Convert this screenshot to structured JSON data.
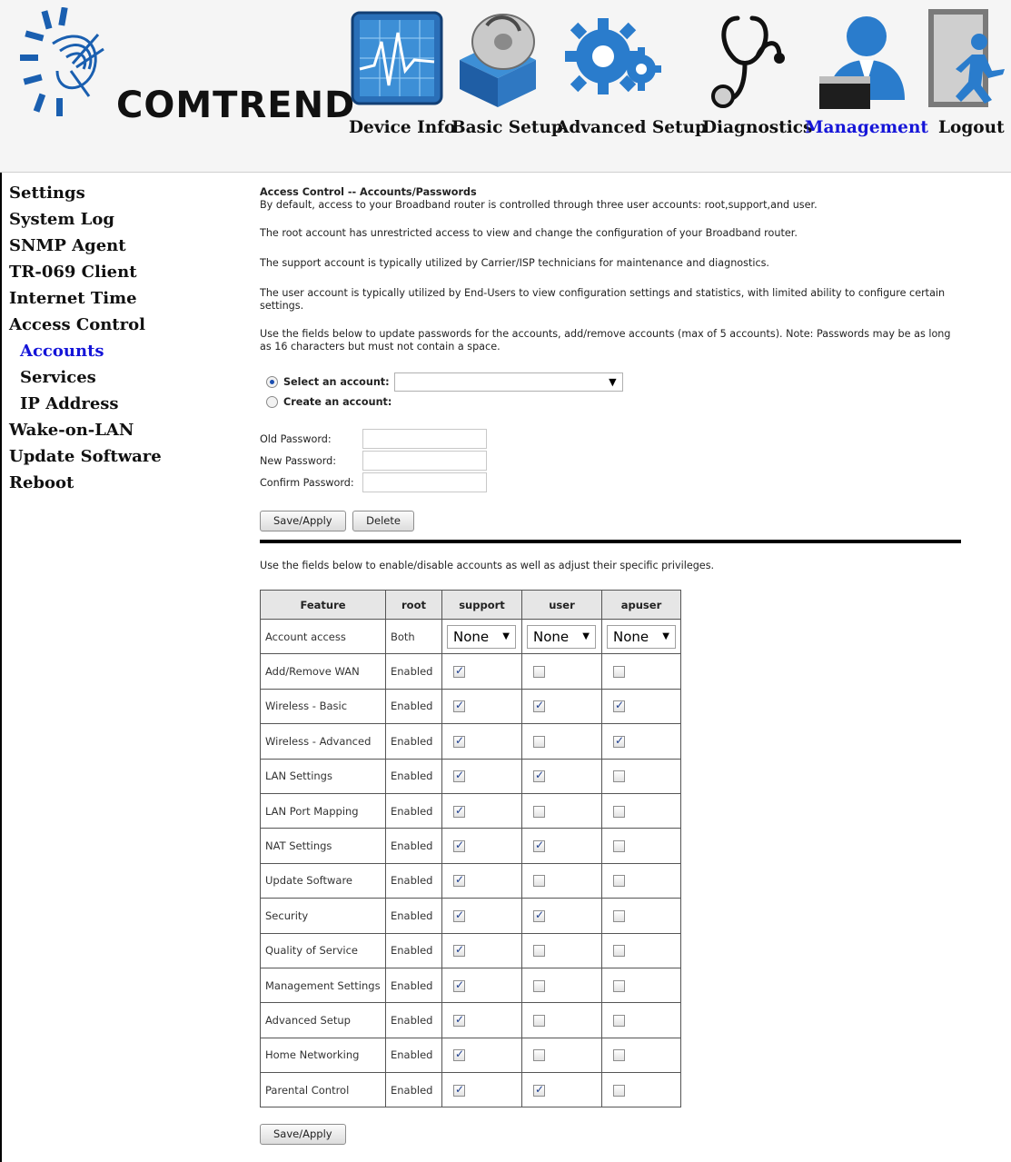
{
  "brand": {
    "name": "COMTREND"
  },
  "nav": [
    {
      "label": "Device Info",
      "icon": "device-info-icon"
    },
    {
      "label": "Basic Setup",
      "icon": "basic-setup-icon"
    },
    {
      "label": "Advanced Setup",
      "icon": "advanced-setup-icon"
    },
    {
      "label": "Diagnostics",
      "icon": "diagnostics-icon"
    },
    {
      "label": "Management",
      "icon": "management-icon",
      "active": true
    },
    {
      "label": "Logout",
      "icon": "logout-icon"
    }
  ],
  "sidebar": {
    "items": [
      {
        "label": "Settings"
      },
      {
        "label": "System Log"
      },
      {
        "label": "SNMP Agent"
      },
      {
        "label": "TR-069 Client"
      },
      {
        "label": "Internet Time"
      },
      {
        "label": "Access Control"
      },
      {
        "label": "Accounts",
        "sub": true,
        "active": true
      },
      {
        "label": "Services",
        "sub": true
      },
      {
        "label": "IP Address",
        "sub": true
      },
      {
        "label": "Wake-on-LAN"
      },
      {
        "label": "Update Software"
      },
      {
        "label": "Reboot"
      }
    ]
  },
  "main": {
    "title": "Access Control -- Accounts/Passwords",
    "intro": "By default, access to your Broadband router is controlled through three user accounts: root,support,and user.",
    "p_root": "The root account has unrestricted access to view and change the configuration of your Broadband router.",
    "p_support": "The support account is typically utilized by Carrier/ISP technicians for maintenance and diagnostics.",
    "p_user": "The user account is typically utilized by End-Users to view configuration settings and statistics, with limited ability to configure certain settings.",
    "p_fields": "Use the fields below to update passwords for the accounts, add/remove accounts (max of 5 accounts). Note: Passwords may be as long as 16 characters but must not contain a space.",
    "select_account_label": "Select an account:",
    "select_account_value": "",
    "create_account_label": "Create an account:",
    "old_password_label": "Old Password:",
    "new_password_label": "New Password:",
    "confirm_password_label": "Confirm Password:",
    "save_apply_label": "Save/Apply",
    "delete_label": "Delete",
    "privileges_intro": "Use the fields below to enable/disable accounts as well as adjust their specific privileges.",
    "save_apply_bottom_label": "Save/Apply"
  },
  "table": {
    "headers": [
      "Feature",
      "root",
      "support",
      "user",
      "apuser"
    ],
    "account_access": {
      "feature": "Account access",
      "root": "Both",
      "support": "None",
      "user": "None",
      "apuser": "None"
    },
    "rows": [
      {
        "feature": "Add/Remove WAN",
        "root": "Enabled",
        "support": true,
        "user": false,
        "apuser": false
      },
      {
        "feature": "Wireless - Basic",
        "root": "Enabled",
        "support": true,
        "user": true,
        "apuser": true
      },
      {
        "feature": "Wireless - Advanced",
        "root": "Enabled",
        "support": true,
        "user": false,
        "apuser": true
      },
      {
        "feature": "LAN Settings",
        "root": "Enabled",
        "support": true,
        "user": true,
        "apuser": false
      },
      {
        "feature": "LAN Port Mapping",
        "root": "Enabled",
        "support": true,
        "user": false,
        "apuser": false
      },
      {
        "feature": "NAT Settings",
        "root": "Enabled",
        "support": true,
        "user": true,
        "apuser": false
      },
      {
        "feature": "Update Software",
        "root": "Enabled",
        "support": true,
        "user": false,
        "apuser": false
      },
      {
        "feature": "Security",
        "root": "Enabled",
        "support": true,
        "user": true,
        "apuser": false
      },
      {
        "feature": "Quality of Service",
        "root": "Enabled",
        "support": true,
        "user": false,
        "apuser": false
      },
      {
        "feature": "Management Settings",
        "root": "Enabled",
        "support": true,
        "user": false,
        "apuser": false
      },
      {
        "feature": "Advanced Setup",
        "root": "Enabled",
        "support": true,
        "user": false,
        "apuser": false
      },
      {
        "feature": "Home Networking",
        "root": "Enabled",
        "support": true,
        "user": false,
        "apuser": false
      },
      {
        "feature": "Parental Control",
        "root": "Enabled",
        "support": true,
        "user": true,
        "apuser": false
      }
    ]
  },
  "colors": {
    "active_link": "#1515d8",
    "checkbox_mark": "#1f3f8f"
  }
}
